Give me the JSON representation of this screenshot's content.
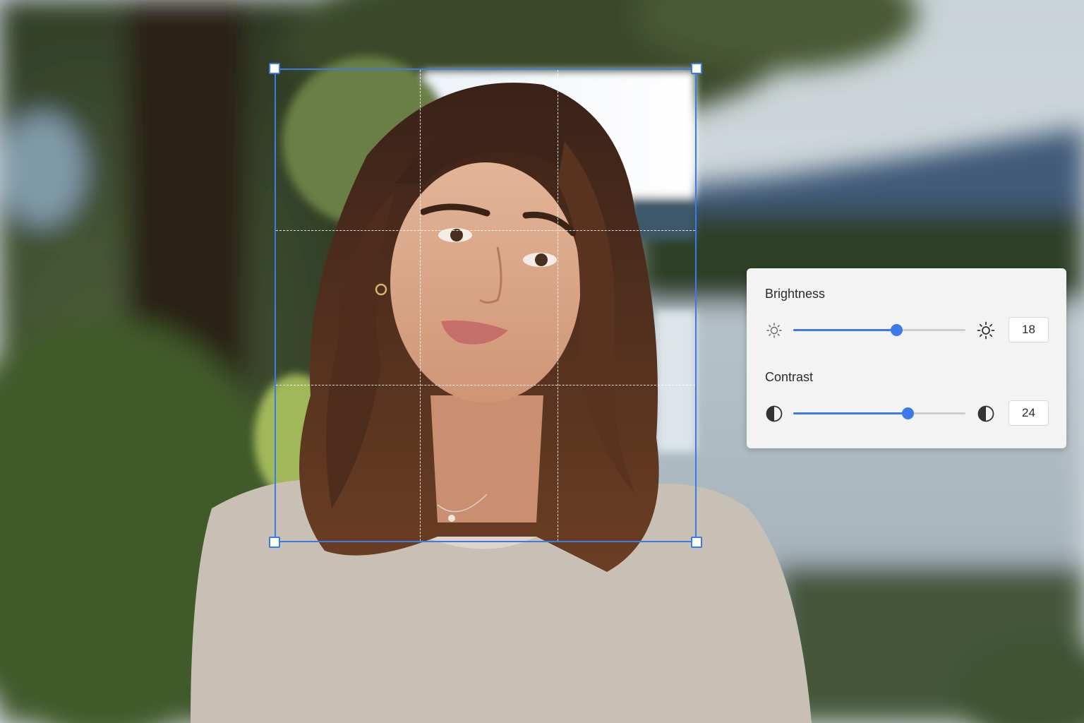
{
  "photo": {
    "subject": "portrait-of-smiling-woman",
    "crop_grid": "rule-of-thirds"
  },
  "adjustments": {
    "brightness": {
      "label": "Brightness",
      "value": "18",
      "slider_fraction": 0.6,
      "icon_low": "sun-low-icon",
      "icon_high": "sun-high-icon"
    },
    "contrast": {
      "label": "Contrast",
      "value": "24",
      "slider_fraction": 0.665,
      "icon_low": "contrast-icon",
      "icon_high": "contrast-icon"
    }
  },
  "colors": {
    "accent": "#3b7ae8",
    "panel_bg": "#f3f3f3",
    "text": "#2b2b2b"
  }
}
